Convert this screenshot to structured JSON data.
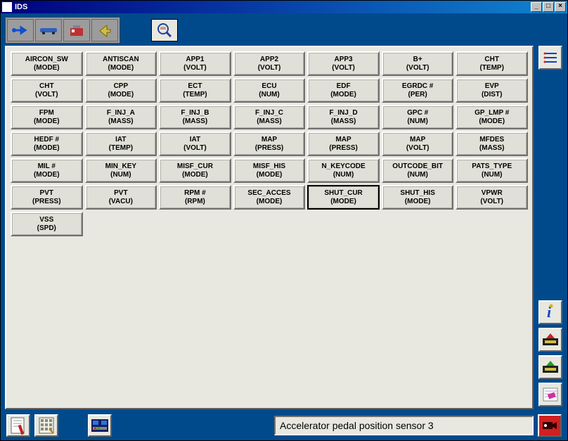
{
  "window": {
    "title": "IDS"
  },
  "status": {
    "text": "Accelerator pedal position sensor 3"
  },
  "selected_index": 39,
  "params": [
    {
      "name": "AIRCON_SW",
      "unit": "(MODE)"
    },
    {
      "name": "ANTISCAN",
      "unit": "(MODE)"
    },
    {
      "name": "APP1",
      "unit": "(VOLT)"
    },
    {
      "name": "APP2",
      "unit": "(VOLT)"
    },
    {
      "name": "APP3",
      "unit": "(VOLT)"
    },
    {
      "name": "B+",
      "unit": "(VOLT)"
    },
    {
      "name": "CHT",
      "unit": "(TEMP)"
    },
    {
      "name": "CHT",
      "unit": "(VOLT)"
    },
    {
      "name": "CPP",
      "unit": "(MODE)"
    },
    {
      "name": "ECT",
      "unit": "(TEMP)"
    },
    {
      "name": "ECU",
      "unit": "(NUM)"
    },
    {
      "name": "EDF",
      "unit": "(MODE)"
    },
    {
      "name": "EGRDC #",
      "unit": "(PER)"
    },
    {
      "name": "EVP",
      "unit": "(DIST)"
    },
    {
      "name": "FPM",
      "unit": "(MODE)"
    },
    {
      "name": "F_INJ_A",
      "unit": "(MASS)"
    },
    {
      "name": "F_INJ_B",
      "unit": "(MASS)"
    },
    {
      "name": "F_INJ_C",
      "unit": "(MASS)"
    },
    {
      "name": "F_INJ_D",
      "unit": "(MASS)"
    },
    {
      "name": "GPC #",
      "unit": "(NUM)"
    },
    {
      "name": "GP_LMP #",
      "unit": "(MODE)"
    },
    {
      "name": "HEDF #",
      "unit": "(MODE)"
    },
    {
      "name": "IAT",
      "unit": "(TEMP)"
    },
    {
      "name": "IAT",
      "unit": "(VOLT)"
    },
    {
      "name": "MAP",
      "unit": "(PRESS)"
    },
    {
      "name": "MAP",
      "unit": "(PRESS)"
    },
    {
      "name": "MAP",
      "unit": "(VOLT)"
    },
    {
      "name": "MFDES",
      "unit": "(MASS)"
    },
    {
      "name": "MIL #",
      "unit": "(MODE)"
    },
    {
      "name": "MIN_KEY",
      "unit": "(NUM)"
    },
    {
      "name": "MISF_CUR",
      "unit": "(MODE)"
    },
    {
      "name": "MISF_HIS",
      "unit": "(MODE)"
    },
    {
      "name": "N_KEYCODE",
      "unit": "(NUM)"
    },
    {
      "name": "OUTCODE_BIT",
      "unit": "(NUM)"
    },
    {
      "name": "PATS_TYPE",
      "unit": "(NUM)"
    },
    {
      "name": "PVT",
      "unit": "(PRESS)"
    },
    {
      "name": "PVT",
      "unit": "(VACU)"
    },
    {
      "name": "RPM #",
      "unit": "(RPM)"
    },
    {
      "name": "SEC_ACCES",
      "unit": "(MODE)"
    },
    {
      "name": "SHUT_CUR",
      "unit": "(MODE)"
    },
    {
      "name": "SHUT_HIS",
      "unit": "(MODE)"
    },
    {
      "name": "VPWR",
      "unit": "(VOLT)"
    },
    {
      "name": "VSS",
      "unit": "(SPD)"
    }
  ]
}
